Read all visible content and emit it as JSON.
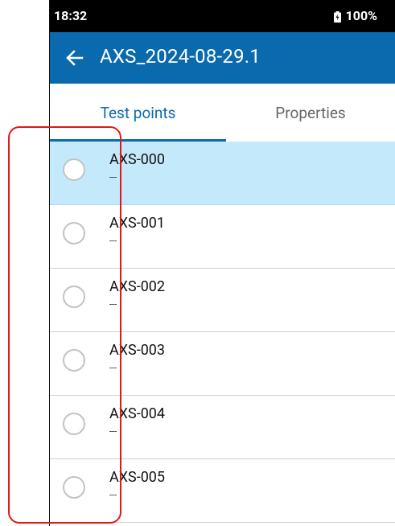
{
  "status_bar": {
    "time": "18:32",
    "battery": "100%"
  },
  "app_bar": {
    "title": "AXS_2024-08-29.1",
    "back_icon": "arrow-left-icon"
  },
  "tabs": [
    {
      "label": "Test points",
      "active": true
    },
    {
      "label": "Properties",
      "active": false
    }
  ],
  "test_points": [
    {
      "name": "AXS-000",
      "detail": "---",
      "selected": true
    },
    {
      "name": "AXS-001",
      "detail": "---",
      "selected": false
    },
    {
      "name": "AXS-002",
      "detail": "---",
      "selected": false
    },
    {
      "name": "AXS-003",
      "detail": "---",
      "selected": false
    },
    {
      "name": "AXS-004",
      "detail": "---",
      "selected": false
    },
    {
      "name": "AXS-005",
      "detail": "---",
      "selected": false
    }
  ],
  "colors": {
    "primary": "#0b6aad",
    "selected_row": "#c4e9fb",
    "annotation": "#e01818"
  }
}
